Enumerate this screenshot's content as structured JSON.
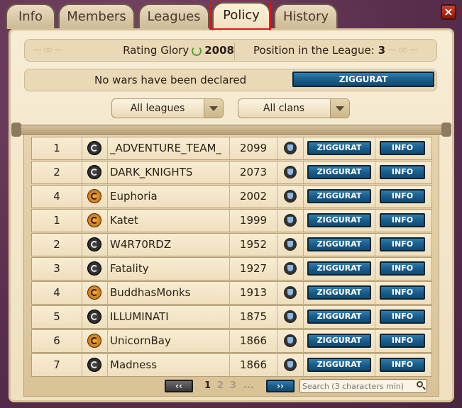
{
  "tabs": [
    {
      "label": "Info"
    },
    {
      "label": "Members"
    },
    {
      "label": "Leagues"
    },
    {
      "label": "Policy",
      "active": true
    },
    {
      "label": "History"
    }
  ],
  "close_label": "×",
  "rating": {
    "label": "Rating Glory",
    "value": "2008"
  },
  "position": {
    "label": "Position in the League:",
    "value": "3"
  },
  "wars": {
    "message": "No wars have been declared",
    "button": "ZIGGURAT"
  },
  "filters": {
    "leagues": "All leagues",
    "clans": "All clans"
  },
  "rows": [
    {
      "rank": "1",
      "emblem": "dark",
      "name": "_ADVENTURE_TEAM_",
      "score": "2099",
      "zig": "ZIGGURAT",
      "info": "INFO"
    },
    {
      "rank": "2",
      "emblem": "dark",
      "name": "DARK_KNIGHTS",
      "score": "2073",
      "zig": "ZIGGURAT",
      "info": "INFO"
    },
    {
      "rank": "4",
      "emblem": "gold",
      "name": "Euphoria",
      "score": "2002",
      "zig": "ZIGGURAT",
      "info": "INFO"
    },
    {
      "rank": "1",
      "emblem": "gold",
      "name": "Katet",
      "score": "1999",
      "zig": "ZIGGURAT",
      "info": "INFO"
    },
    {
      "rank": "2",
      "emblem": "dark",
      "name": "W4R70RDZ",
      "score": "1952",
      "zig": "ZIGGURAT",
      "info": "INFO"
    },
    {
      "rank": "3",
      "emblem": "dark",
      "name": "Fatality",
      "score": "1927",
      "zig": "ZIGGURAT",
      "info": "INFO"
    },
    {
      "rank": "4",
      "emblem": "gold",
      "name": "BuddhasMonks",
      "score": "1913",
      "zig": "ZIGGURAT",
      "info": "INFO"
    },
    {
      "rank": "5",
      "emblem": "dark",
      "name": "ILLUMINATI",
      "score": "1875",
      "zig": "ZIGGURAT",
      "info": "INFO"
    },
    {
      "rank": "6",
      "emblem": "gold",
      "name": "UnicornBay",
      "score": "1866",
      "zig": "ZIGGURAT",
      "info": "INFO"
    },
    {
      "rank": "7",
      "emblem": "dark",
      "name": "Madness",
      "score": "1866",
      "zig": "ZIGGURAT",
      "info": "INFO"
    }
  ],
  "pager": {
    "prev": "‹‹",
    "next": "››",
    "pages": [
      "1",
      "2",
      "3",
      "..."
    ],
    "current": "1"
  },
  "search": {
    "placeholder": "Search (3 characters min)"
  }
}
